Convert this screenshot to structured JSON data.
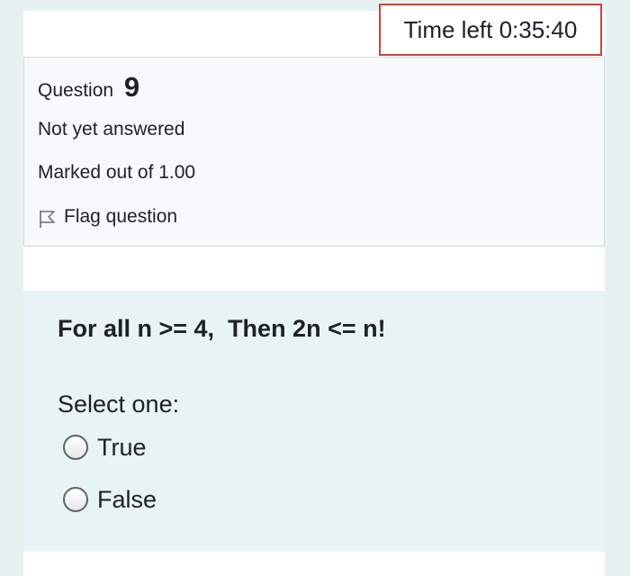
{
  "timer": {
    "text": "Time left 0:35:40"
  },
  "question_info": {
    "label": "Question",
    "number": "9",
    "state": "Not yet answered",
    "grade": "Marked out of 1.00",
    "flag_label": "Flag question",
    "flag_icon": "flag-outline-icon"
  },
  "question": {
    "text": "For all n >= 4,  Then 2n <= n!",
    "prompt": "Select one:",
    "options": [
      {
        "label": "True",
        "selected": false
      },
      {
        "label": "False",
        "selected": false
      }
    ]
  },
  "colors": {
    "background": "#e5f2ef",
    "timer_border": "#c9443c",
    "info_background": "#f8f9fa",
    "formulation_background": "#e7f3f5",
    "text": "#1d2125"
  }
}
